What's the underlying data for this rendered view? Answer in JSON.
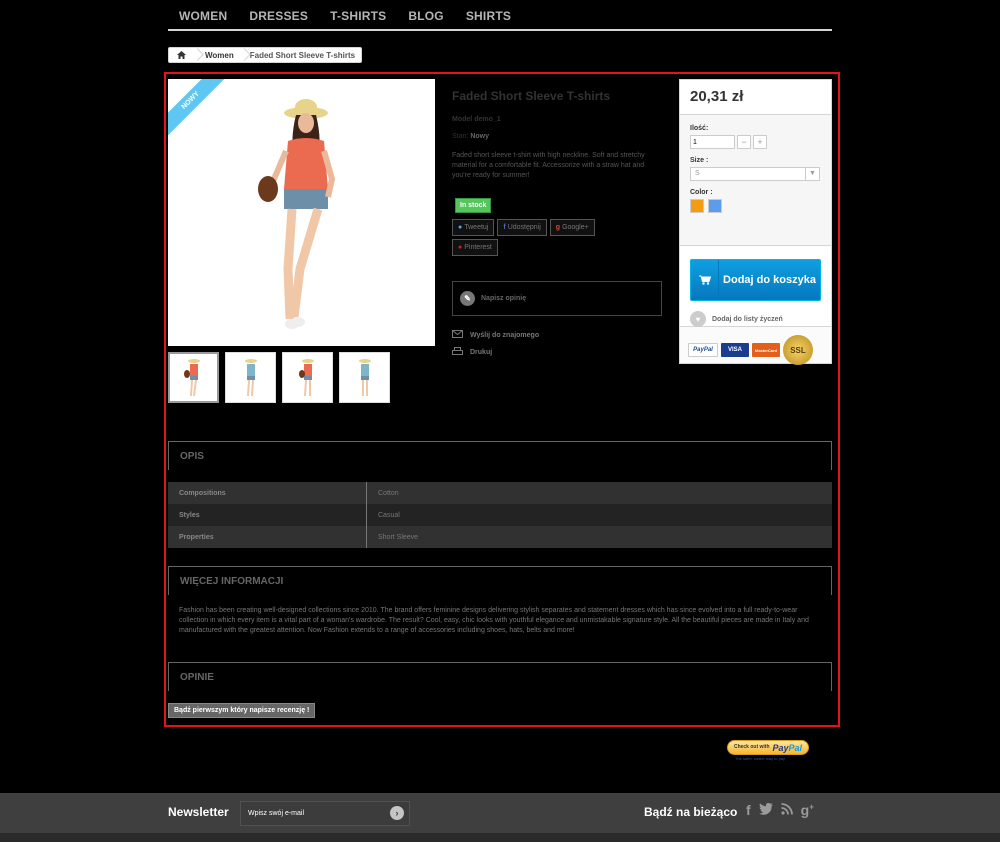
{
  "nav": {
    "items": [
      "WOMEN",
      "DRESSES",
      "T-SHIRTS",
      "BLOG",
      "SHIRTS"
    ]
  },
  "breadcrumb": {
    "home_icon": "home-icon",
    "category": "Women",
    "current": "Faded Short Sleeve T-shirts"
  },
  "product": {
    "badge": "NOWY",
    "name": "Faded Short Sleeve T-shirts",
    "model_label": "Model",
    "model": "demo_1",
    "state_label": "Stan:",
    "state": "Nowy",
    "description": "Faded short sleeve t-shirt with high neckline. Soft and stretchy material for a comfortable fit. Accessorize with a straw hat and you're ready for summer!",
    "stock": "In stock",
    "share": [
      "Tweetuj",
      "Udostępnij",
      "Google+",
      "Pinterest"
    ],
    "review_label": "Napisz opinię",
    "send_friend": "Wyślij do znajomego",
    "print": "Drukuj",
    "thumbnail_count": 4
  },
  "buy": {
    "price": "20,31 zł",
    "qty_label": "Ilość:",
    "qty_value": "1",
    "size_label": "Size :",
    "size_value": "S",
    "color_label": "Color :",
    "colors": [
      "#f39c11",
      "#5d9cec"
    ],
    "add_to_cart": "Dodaj do koszyka",
    "wishlist": "Dodaj do listy życzeń",
    "cards": [
      "PayPal",
      "VISA",
      "MasterCard"
    ],
    "ssl": "SSL"
  },
  "sections": {
    "data_sheet": "OPIS",
    "more_info": "WIĘCEJ INFORMACJI",
    "reviews": "OPINIE"
  },
  "features": [
    {
      "name": "Compositions",
      "value": "Cotton"
    },
    {
      "name": "Styles",
      "value": "Casual"
    },
    {
      "name": "Properties",
      "value": "Short Sleeve"
    }
  ],
  "more_info_text": "Fashion has been creating well-designed collections since 2010. The brand offers feminine designs delivering stylish separates and statement dresses which has since evolved into a full ready-to-wear collection in which every item is a vital part of a woman's wardrobe. The result? Cool, easy, chic looks with youthful elegance and unmistakable signature style. All the beautiful pieces are made in Italy and manufactured with the greatest attention. Now Fashion extends to a range of accessories including shoes, hats, belts and more!",
  "first_review_button": "Bądź pierwszym który napisze recenzję !",
  "paypal": {
    "checkout": "Check out with",
    "brand_pay": "Pay",
    "brand_pal": "Pal",
    "tagline": "The safer, easier way to pay"
  },
  "footer": {
    "newsletter_label": "Newsletter",
    "newsletter_placeholder": "Wpisz swój e-mail",
    "follow_label": "Bądź na bieżąco",
    "socials": [
      "facebook-icon",
      "twitter-icon",
      "rss-icon",
      "google-plus-icon"
    ]
  }
}
